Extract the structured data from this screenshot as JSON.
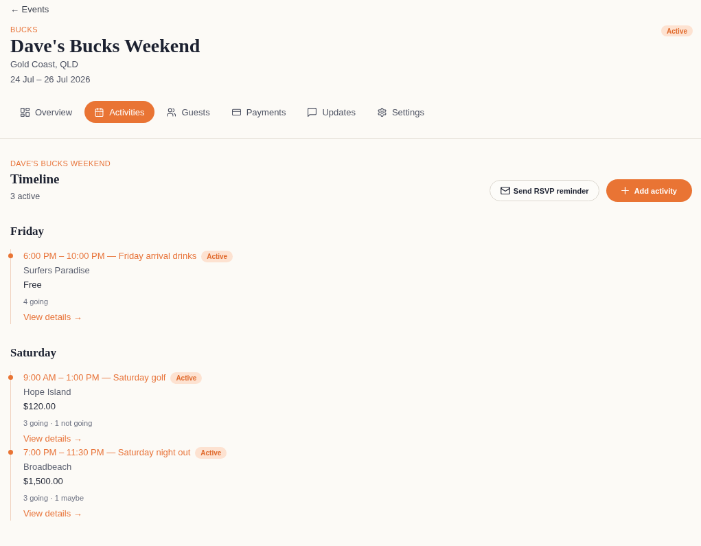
{
  "back_link": "← Events",
  "event": {
    "category": "BUCKS",
    "title": "Dave's Bucks Weekend",
    "location": "Gold Coast, QLD",
    "dates": "24 Jul – 26 Jul 2026",
    "status": "Active"
  },
  "tabs": [
    {
      "label": "Overview",
      "selected": false
    },
    {
      "label": "Activities",
      "selected": true
    },
    {
      "label": "Guests",
      "selected": false
    },
    {
      "label": "Payments",
      "selected": false
    },
    {
      "label": "Updates",
      "selected": false
    },
    {
      "label": "Settings",
      "selected": false
    }
  ],
  "section": {
    "eyebrow": "DAVE'S BUCKS WEEKEND",
    "title": "Timeline",
    "summary": "3 active"
  },
  "buttons": [
    {
      "label": "Send RSVP reminder",
      "kind": "secondary"
    },
    {
      "label": "Add activity",
      "kind": "primary"
    }
  ],
  "days": [
    {
      "label": "Friday",
      "activities": [
        {
          "title": "6:00 PM – 10:00 PM — Friday arrival drinks",
          "status": "Active",
          "location": "Surfers Paradise",
          "price": "Free",
          "attendance": "4 going",
          "link": "View details →"
        }
      ]
    },
    {
      "label": "Saturday",
      "activities": [
        {
          "title": "9:00 AM – 1:00 PM — Saturday golf",
          "status": "Active",
          "location": "Hope Island",
          "price": "$120.00",
          "attendance": "3 going · 1 not going",
          "link": "View details →"
        },
        {
          "title": "7:00 PM – 11:30 PM — Saturday night out",
          "status": "Active",
          "location": "Broadbeach",
          "price": "$1,500.00",
          "attendance": "3 going · 1 maybe",
          "link": "View details →"
        }
      ]
    }
  ]
}
